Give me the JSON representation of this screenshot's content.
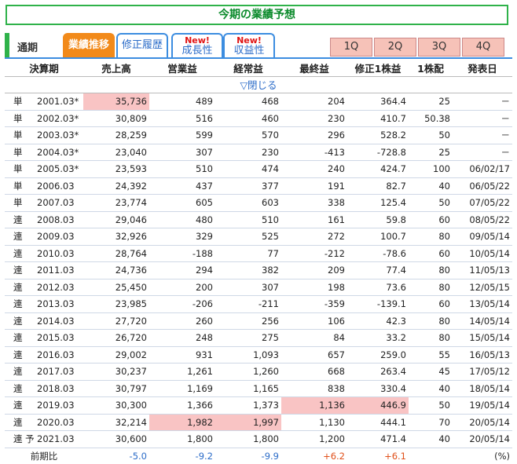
{
  "title": "今期の業績予想",
  "tabs": {
    "label": "通期",
    "items": [
      {
        "new": "",
        "label": "業績推移",
        "active": true
      },
      {
        "new": "",
        "label": "修正履歴",
        "active": false
      },
      {
        "new": "New!",
        "label": "成長性",
        "active": false
      },
      {
        "new": "New!",
        "label": "収益性",
        "active": false
      }
    ],
    "quarters": [
      "1Q",
      "2Q",
      "3Q",
      "4Q"
    ]
  },
  "headers": [
    "決算期",
    "売上高",
    "営業益",
    "経常益",
    "最終益",
    "修正1株益",
    "1株配",
    "発表日"
  ],
  "collapse_label": "▽閉じる",
  "rows": [
    {
      "type": "単",
      "period": "2001.03*",
      "sales": "35,736",
      "op": "489",
      "ord": "468",
      "net": "204",
      "eps": "364.4",
      "div": "25",
      "date": "－",
      "hl": [
        "sales"
      ]
    },
    {
      "type": "単",
      "period": "2002.03*",
      "sales": "30,809",
      "op": "516",
      "ord": "460",
      "net": "230",
      "eps": "410.7",
      "div": "50.38",
      "date": "－",
      "hl": []
    },
    {
      "type": "単",
      "period": "2003.03*",
      "sales": "28,259",
      "op": "599",
      "ord": "570",
      "net": "296",
      "eps": "528.2",
      "div": "50",
      "date": "－",
      "hl": []
    },
    {
      "type": "単",
      "period": "2004.03*",
      "sales": "23,040",
      "op": "307",
      "ord": "230",
      "net": "-413",
      "eps": "-728.8",
      "div": "25",
      "date": "－",
      "hl": []
    },
    {
      "type": "単",
      "period": "2005.03*",
      "sales": "23,593",
      "op": "510",
      "ord": "474",
      "net": "240",
      "eps": "424.7",
      "div": "100",
      "date": "06/02/17",
      "hl": []
    },
    {
      "type": "単",
      "period": "2006.03",
      "sales": "24,392",
      "op": "437",
      "ord": "377",
      "net": "191",
      "eps": "82.7",
      "div": "40",
      "date": "06/05/22",
      "hl": []
    },
    {
      "type": "単",
      "period": "2007.03",
      "sales": "23,774",
      "op": "605",
      "ord": "603",
      "net": "338",
      "eps": "125.4",
      "div": "50",
      "date": "07/05/22",
      "hl": []
    },
    {
      "type": "連",
      "period": "2008.03",
      "sales": "29,046",
      "op": "480",
      "ord": "510",
      "net": "161",
      "eps": "59.8",
      "div": "60",
      "date": "08/05/22",
      "hl": []
    },
    {
      "type": "連",
      "period": "2009.03",
      "sales": "32,926",
      "op": "329",
      "ord": "525",
      "net": "272",
      "eps": "100.7",
      "div": "80",
      "date": "09/05/14",
      "hl": []
    },
    {
      "type": "連",
      "period": "2010.03",
      "sales": "28,764",
      "op": "-188",
      "ord": "77",
      "net": "-212",
      "eps": "-78.6",
      "div": "60",
      "date": "10/05/14",
      "hl": []
    },
    {
      "type": "連",
      "period": "2011.03",
      "sales": "24,736",
      "op": "294",
      "ord": "382",
      "net": "209",
      "eps": "77.4",
      "div": "80",
      "date": "11/05/13",
      "hl": []
    },
    {
      "type": "連",
      "period": "2012.03",
      "sales": "25,450",
      "op": "200",
      "ord": "307",
      "net": "198",
      "eps": "73.6",
      "div": "80",
      "date": "12/05/15",
      "hl": []
    },
    {
      "type": "連",
      "period": "2013.03",
      "sales": "23,985",
      "op": "-206",
      "ord": "-211",
      "net": "-359",
      "eps": "-139.1",
      "div": "60",
      "date": "13/05/14",
      "hl": []
    },
    {
      "type": "連",
      "period": "2014.03",
      "sales": "27,720",
      "op": "260",
      "ord": "256",
      "net": "106",
      "eps": "42.3",
      "div": "80",
      "date": "14/05/14",
      "hl": []
    },
    {
      "type": "連",
      "period": "2015.03",
      "sales": "26,720",
      "op": "248",
      "ord": "275",
      "net": "84",
      "eps": "33.2",
      "div": "80",
      "date": "15/05/14",
      "hl": []
    },
    {
      "type": "連",
      "period": "2016.03",
      "sales": "29,002",
      "op": "931",
      "ord": "1,093",
      "net": "657",
      "eps": "259.0",
      "div": "55",
      "date": "16/05/13",
      "hl": []
    },
    {
      "type": "連",
      "period": "2017.03",
      "sales": "30,237",
      "op": "1,261",
      "ord": "1,260",
      "net": "668",
      "eps": "263.4",
      "div": "45",
      "date": "17/05/12",
      "hl": []
    },
    {
      "type": "連",
      "period": "2018.03",
      "sales": "30,797",
      "op": "1,169",
      "ord": "1,165",
      "net": "838",
      "eps": "330.4",
      "div": "40",
      "date": "18/05/14",
      "hl": []
    },
    {
      "type": "連",
      "period": "2019.03",
      "sales": "30,300",
      "op": "1,366",
      "ord": "1,373",
      "net": "1,136",
      "eps": "446.9",
      "div": "50",
      "date": "19/05/14",
      "hl": [
        "net",
        "eps"
      ]
    },
    {
      "type": "連",
      "period": "2020.03",
      "sales": "32,214",
      "op": "1,982",
      "ord": "1,997",
      "net": "1,130",
      "eps": "444.1",
      "div": "70",
      "date": "20/05/14",
      "hl": [
        "op",
        "ord"
      ]
    },
    {
      "type": "連 予",
      "period": "2021.03",
      "sales": "30,600",
      "op": "1,800",
      "ord": "1,800",
      "net": "1,200",
      "eps": "471.4",
      "div": "40",
      "date": "20/05/14",
      "hl": []
    }
  ],
  "ratio": {
    "label": "前期比",
    "sales": "-5.0",
    "op": "-9.2",
    "ord": "-9.9",
    "net": "+6.2",
    "eps": "+6.1",
    "unit": "(%)"
  }
}
